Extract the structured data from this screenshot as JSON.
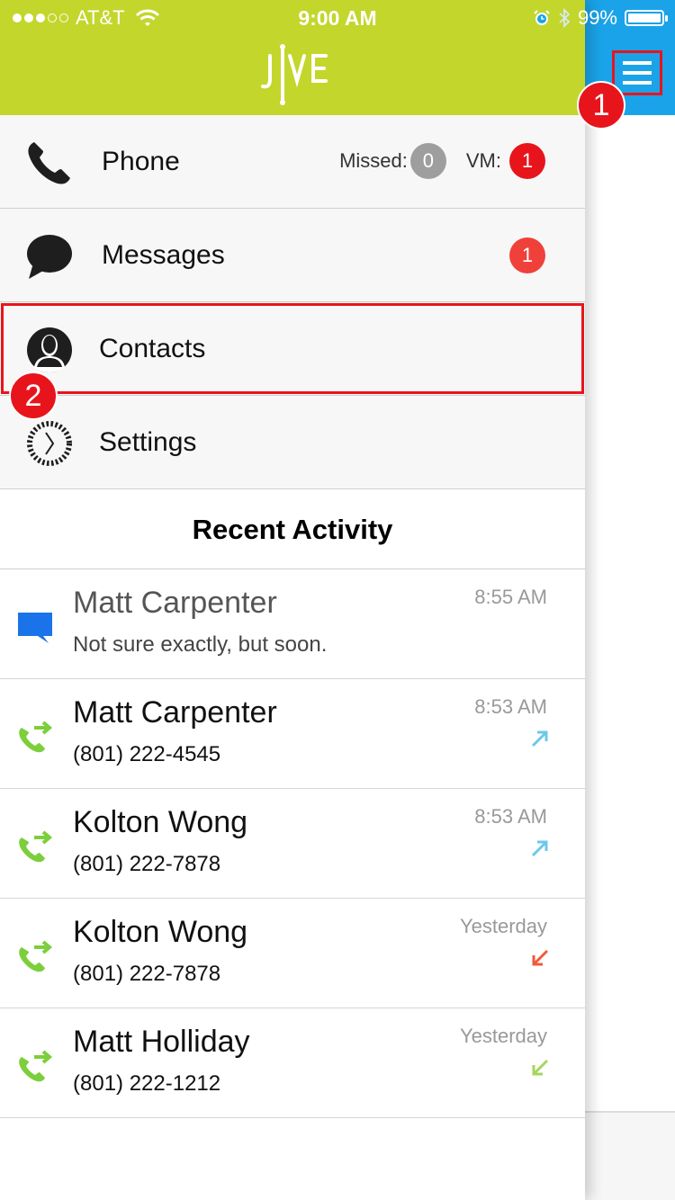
{
  "status_bar": {
    "carrier": "AT&T",
    "time": "9:00 AM",
    "battery": "99%"
  },
  "menu": {
    "phone": {
      "label": "Phone",
      "missed_label": "Missed:",
      "missed_count": "0",
      "vm_label": "VM:",
      "vm_count": "1"
    },
    "messages": {
      "label": "Messages",
      "badge": "1"
    },
    "contacts": {
      "label": "Contacts"
    },
    "settings": {
      "label": "Settings"
    }
  },
  "annotations": {
    "callout1": "1",
    "callout2": "2"
  },
  "recent": {
    "title": "Recent Activity",
    "items": [
      {
        "type": "message",
        "name": "Matt Carpenter",
        "detail": "Not sure exactly, but soon.",
        "time": "8:55 AM"
      },
      {
        "type": "call",
        "name": "Matt Carpenter",
        "detail": "(801) 222-4545",
        "time": "8:53 AM",
        "direction": "outgoing"
      },
      {
        "type": "call",
        "name": "Kolton Wong",
        "detail": "(801) 222-7878",
        "time": "8:53 AM",
        "direction": "outgoing"
      },
      {
        "type": "call",
        "name": "Kolton Wong",
        "detail": "(801) 222-7878",
        "time": "Yesterday",
        "direction": "missed"
      },
      {
        "type": "call",
        "name": "Matt Holliday",
        "detail": "(801) 222-1212",
        "time": "Yesterday",
        "direction": "incoming"
      }
    ]
  },
  "colors": {
    "header_green": "#c3d62c",
    "accent_blue": "#1aa3e8",
    "badge_red": "#e8141c",
    "missed_gray": "#9e9e9e",
    "call_green": "#7ccf3b"
  }
}
